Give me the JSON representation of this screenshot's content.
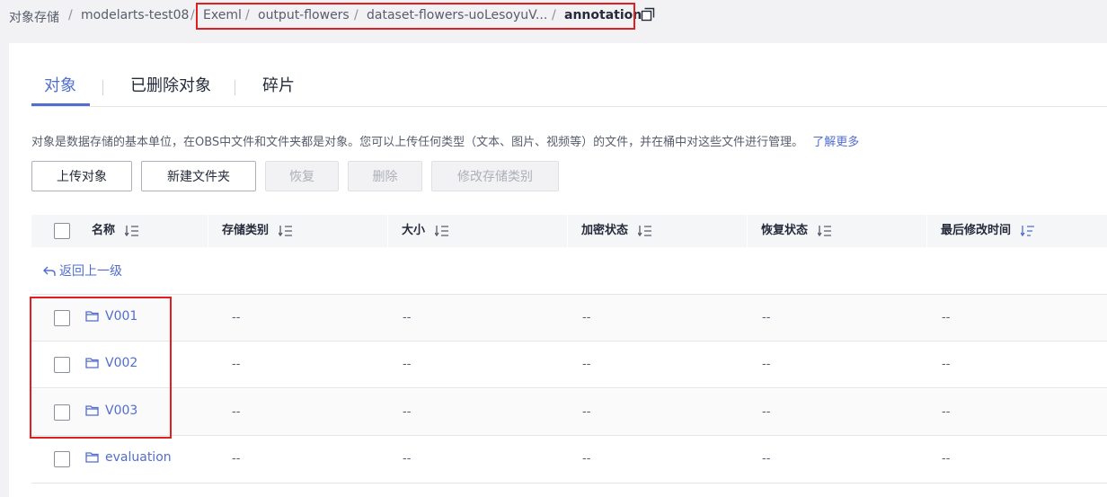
{
  "breadcrumb": {
    "items": [
      "对象存储",
      "modelarts-test08",
      "Exeml",
      "output-flowers",
      "dataset-flowers-uoLesoyuV...",
      "annotation"
    ],
    "separator": "/"
  },
  "tabs": [
    {
      "label": "对象",
      "active": true
    },
    {
      "label": "已删除对象",
      "active": false
    },
    {
      "label": "碎片",
      "active": false
    }
  ],
  "description": {
    "text": "对象是数据存储的基本单位，在OBS中文件和文件夹都是对象。您可以上传任何类型（文本、图片、视频等）的文件，并在桶中对这些文件进行管理。",
    "link": "了解更多"
  },
  "toolbar": {
    "upload_label": "上传对象",
    "new_folder_label": "新建文件夹",
    "restore_label": "恢复",
    "delete_label": "删除",
    "change_class_label": "修改存储类别"
  },
  "table": {
    "headers": [
      "名称",
      "存储类别",
      "大小",
      "加密状态",
      "恢复状态",
      "最后修改时间"
    ],
    "back_label": "返回上一级",
    "rows": [
      {
        "name": "V001",
        "cells": [
          "--",
          "--",
          "--",
          "--",
          "--"
        ]
      },
      {
        "name": "V002",
        "cells": [
          "--",
          "--",
          "--",
          "--",
          "--"
        ]
      },
      {
        "name": "V003",
        "cells": [
          "--",
          "--",
          "--",
          "--",
          "--"
        ]
      },
      {
        "name": "evaluation",
        "cells": [
          "--",
          "--",
          "--",
          "--",
          "--"
        ]
      }
    ]
  },
  "colors": {
    "accent": "#526ecc",
    "highlight": "#e02020",
    "text": "#252b3a",
    "muted": "#575d6c"
  }
}
